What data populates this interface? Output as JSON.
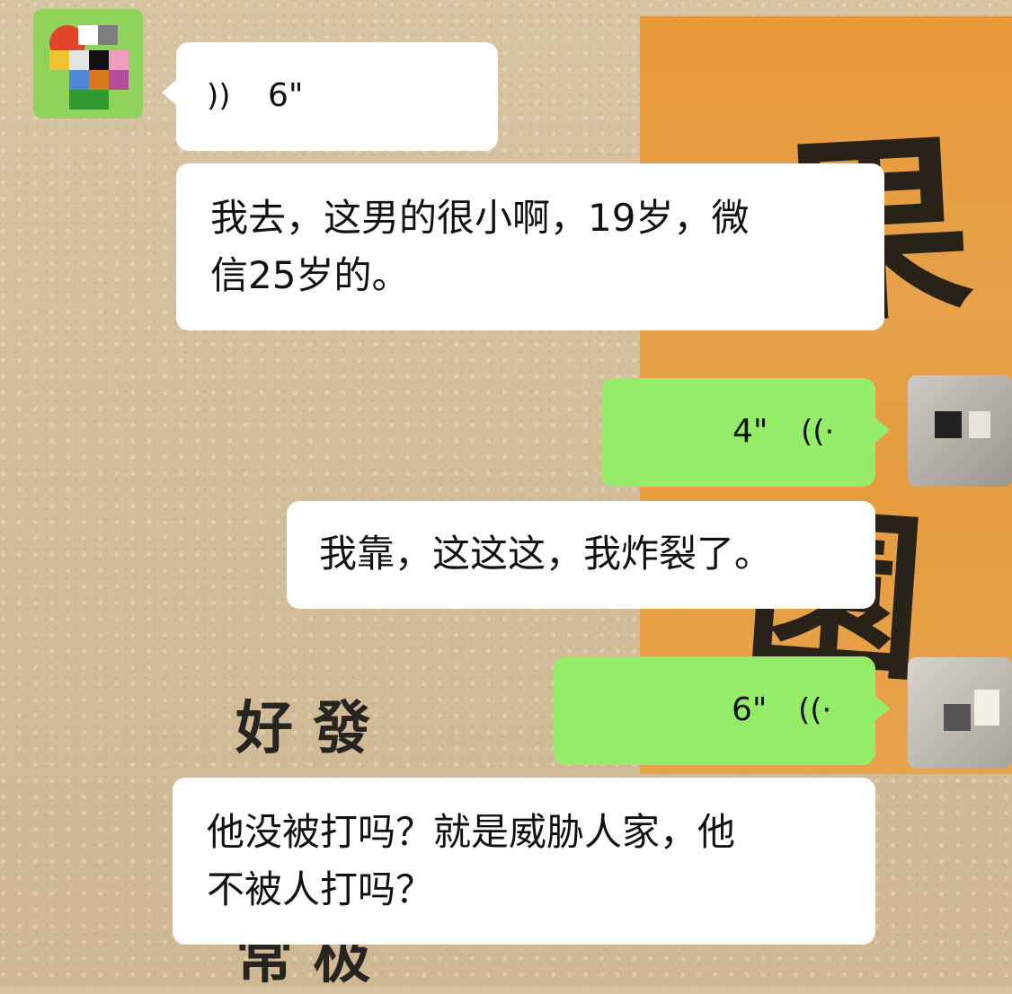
{
  "messages": [
    {
      "id": "m1",
      "side": "left",
      "type": "voice",
      "duration": "6\""
    },
    {
      "id": "m2",
      "side": "left",
      "type": "text",
      "lines": [
        "我去，这男的很小啊，19岁，微",
        "信25岁的。"
      ]
    },
    {
      "id": "m3",
      "side": "right",
      "type": "voice",
      "duration": "4\""
    },
    {
      "id": "m4",
      "side": "left",
      "type": "text",
      "lines": [
        "我靠，这这这，我炸裂了。"
      ]
    },
    {
      "id": "m5",
      "side": "right",
      "type": "voice",
      "duration": "6\""
    },
    {
      "id": "m6",
      "side": "left",
      "type": "text",
      "lines": [
        "他没被打吗？就是威胁人家，他",
        "不被人打吗？"
      ]
    }
  ],
  "wallpaper": {
    "calligraphy": [
      "果",
      "園",
      "好 發",
      "常 极"
    ]
  },
  "colors": {
    "bubble_white": "#ffffff",
    "bubble_green": "#95ec69",
    "panel_orange": "#e89a38",
    "background": "#d6c3a1"
  },
  "icons": {
    "voice_left": "voice-wave-icon",
    "voice_right": "voice-wave-icon"
  }
}
